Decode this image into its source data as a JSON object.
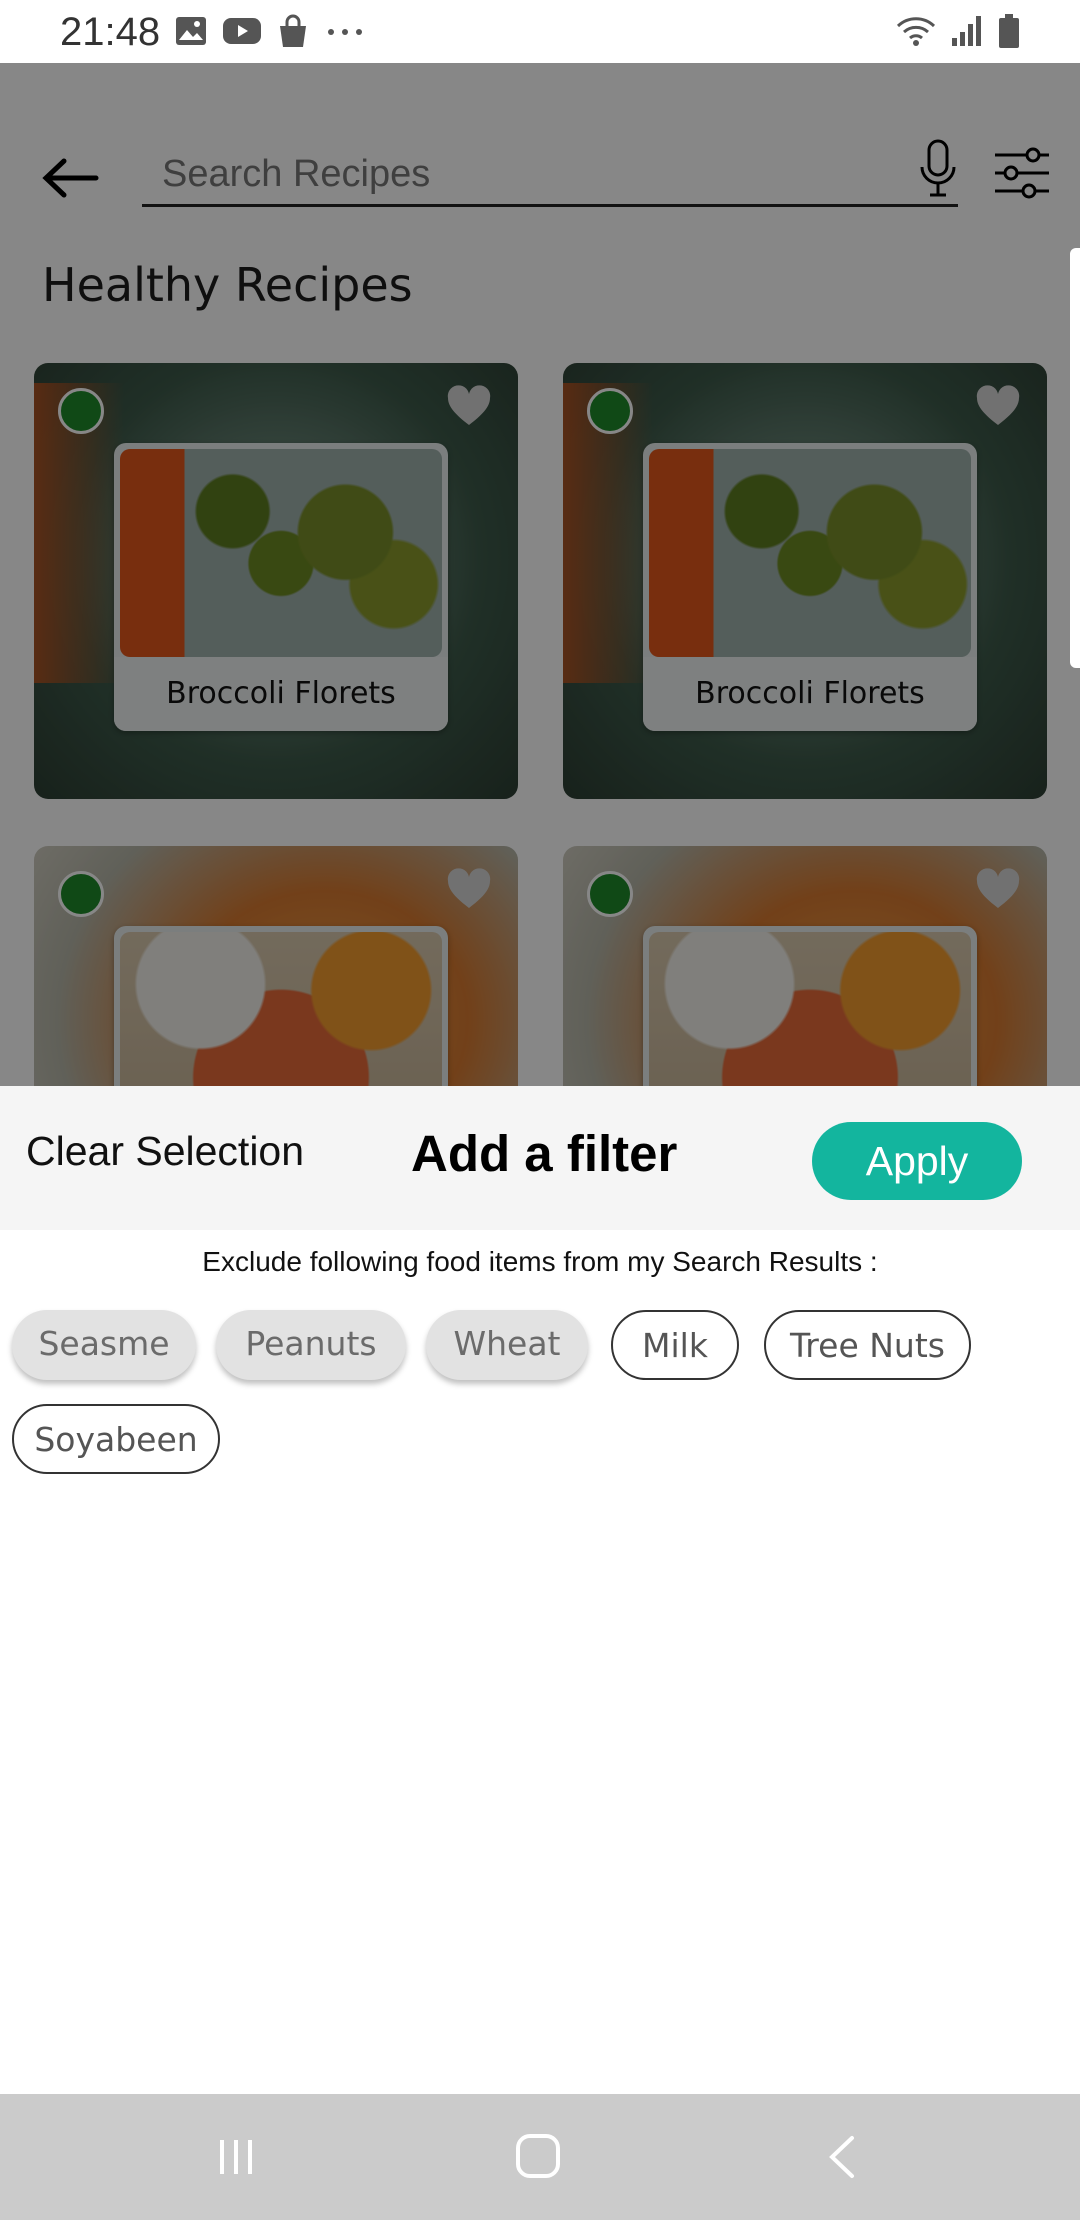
{
  "status_bar": {
    "time": "21:48",
    "left_icons": [
      "image-icon",
      "youtube-icon",
      "bag-icon",
      "more-dots-icon"
    ],
    "right_icons": [
      "wifi-icon",
      "signal-icon",
      "battery-icon"
    ]
  },
  "header": {
    "search_placeholder": "Search Recipes"
  },
  "section": {
    "title": "Healthy Recipes"
  },
  "cards": [
    {
      "title": "Broccoli Florets"
    },
    {
      "title": "Broccoli Florets"
    },
    {
      "title": ""
    },
    {
      "title": ""
    }
  ],
  "filter_sheet": {
    "clear_label": "Clear Selection",
    "title": "Add a filter",
    "apply_label": "Apply",
    "description": "Exclude following food items from my Search Results :",
    "chips": [
      {
        "label": "Seasme",
        "selected": true
      },
      {
        "label": "Peanuts",
        "selected": true
      },
      {
        "label": "Wheat",
        "selected": true
      },
      {
        "label": "Milk",
        "selected": false
      },
      {
        "label": "Tree Nuts",
        "selected": false
      },
      {
        "label": "Soyabeen",
        "selected": false
      }
    ]
  },
  "colors": {
    "accent": "#13b59e",
    "select_dot": "#1f8a2a",
    "nav_bar": "#cbcbcb"
  }
}
